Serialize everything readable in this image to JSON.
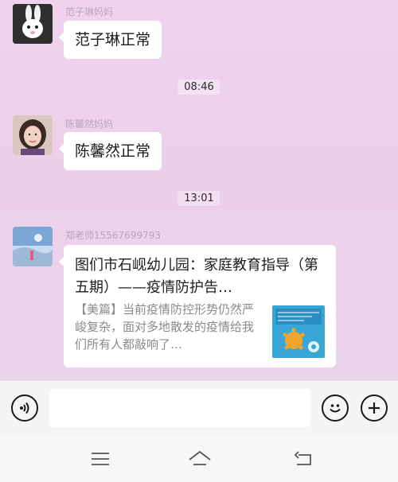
{
  "messages": [
    {
      "sender": "范子琳妈妈",
      "text": "范子琳正常",
      "avatar_icon": "rabbit-avatar"
    },
    {
      "sender": "陈馨然妈妈",
      "text": "陈馨然正常",
      "avatar_icon": "woman-avatar"
    },
    {
      "sender": "郑老师15567699793",
      "avatar_icon": "landscape-avatar"
    }
  ],
  "timestamps": [
    "08:46",
    "13:01"
  ],
  "article_card": {
    "title": "图们市石岘幼儿园：家庭教育指导（第五期）——疫情防护告…",
    "description": "【美篇】当前疫情防控形势仍然严峻复杂，面对多地散发的疫情给我们所有人都敲响了…",
    "thumbnail_icon": "virus-thumbnail"
  },
  "input_bar": {
    "placeholder": "",
    "icons": [
      "voice-icon",
      "emoji-icon",
      "plus-icon"
    ]
  },
  "nav_bar": {
    "icons": [
      "menu-icon",
      "home-icon",
      "back-icon"
    ]
  },
  "colors": {
    "chat_background": "#ecd0ea",
    "bubble": "#ffffff",
    "sender_text": "#b9a8b7",
    "thumbnail": "#3aa6d6"
  }
}
